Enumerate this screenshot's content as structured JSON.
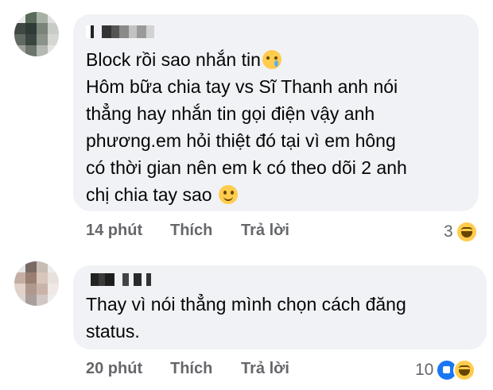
{
  "colors": {
    "bubble": "#f0f2f5",
    "text": "#050505",
    "secondary": "#65676b",
    "like_blue": "#1877f2",
    "emoji_yellow": "#ffcc4d"
  },
  "comments": [
    {
      "text_lines": [
        "Block rồi sao nhắn tin",
        "Hôm bữa chia tay vs Sĩ Thanh anh nói",
        "thẳng hay nhắn tin gọi điện vậy anh",
        "phương.em hỏi thiệt đó tại vì em hông",
        "có thời gian nên em k có theo dõi 2 anh",
        "chị chia tay sao"
      ],
      "emoji_icons": [
        "crying-face-icon",
        "smiling-face-icon"
      ],
      "time": "14 phút",
      "like_label": "Thích",
      "reply_label": "Trả lời",
      "reaction_count": "3",
      "reaction_icons": [
        "haha-icon"
      ]
    },
    {
      "text_lines": [
        "Thay vì nói thẳng mình chọn cách đăng",
        "status."
      ],
      "time": "20 phút",
      "like_label": "Thích",
      "reply_label": "Trả lời",
      "reaction_count": "10",
      "reaction_icons": [
        "like-icon",
        "haha-icon"
      ]
    }
  ]
}
